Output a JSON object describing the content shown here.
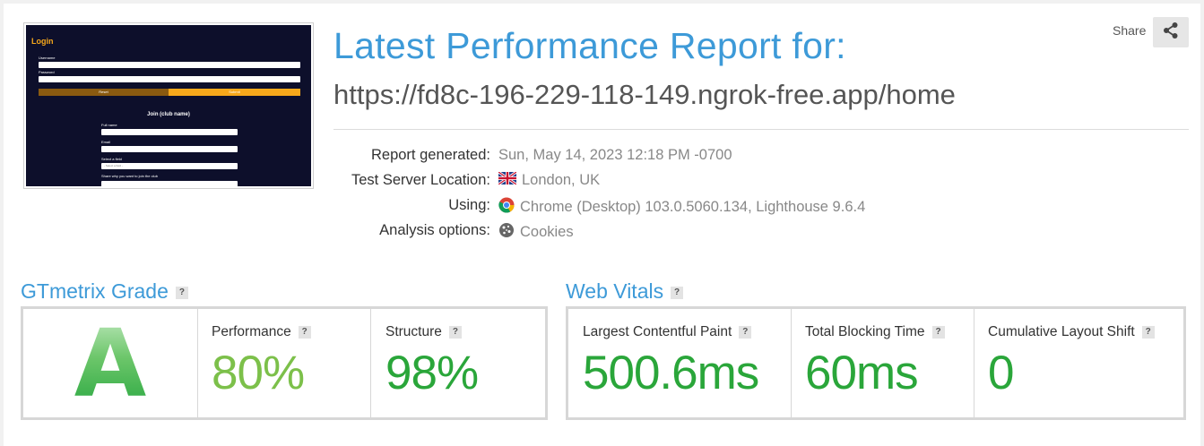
{
  "thumbnail": {
    "login_title": "Login",
    "username_label": "Username",
    "password_label": "Password",
    "reset_label": "Reset",
    "submit_label": "Submit",
    "join_title": "Join (club name)",
    "fullname_label": "Full name",
    "email_label": "Email",
    "field_label": "Select a field",
    "field_placeholder": "- Select a field -",
    "why_label": "Share why you want to join the club"
  },
  "header": {
    "title": "Latest Performance Report for:",
    "url": "https://fd8c-196-229-118-149.ngrok-free.app/home",
    "share_label": "Share"
  },
  "meta": {
    "report_generated_key": "Report generated:",
    "report_generated_value": "Sun, May 14, 2023 12:18 PM -0700",
    "location_key": "Test Server Location:",
    "location_value": "London, UK",
    "using_key": "Using:",
    "using_value": "Chrome (Desktop) 103.0.5060.134, Lighthouse 9.6.4",
    "analysis_key": "Analysis options:",
    "analysis_value": "Cookies"
  },
  "gtmetrix": {
    "title": "GTmetrix Grade",
    "help": "?",
    "grade": "A",
    "performance_label": "Performance",
    "performance_value": "80%",
    "structure_label": "Structure",
    "structure_value": "98%"
  },
  "vitals": {
    "title": "Web Vitals",
    "help": "?",
    "lcp_label": "Largest Contentful Paint",
    "lcp_value": "500.6ms",
    "tbt_label": "Total Blocking Time",
    "tbt_value": "60ms",
    "cls_label": "Cumulative Layout Shift",
    "cls_value": "0"
  },
  "colors": {
    "accent": "#3d9ad8",
    "grade_green": "#22a43c",
    "performance_green": "#7cc04a",
    "good_green": "#2aa63a"
  }
}
